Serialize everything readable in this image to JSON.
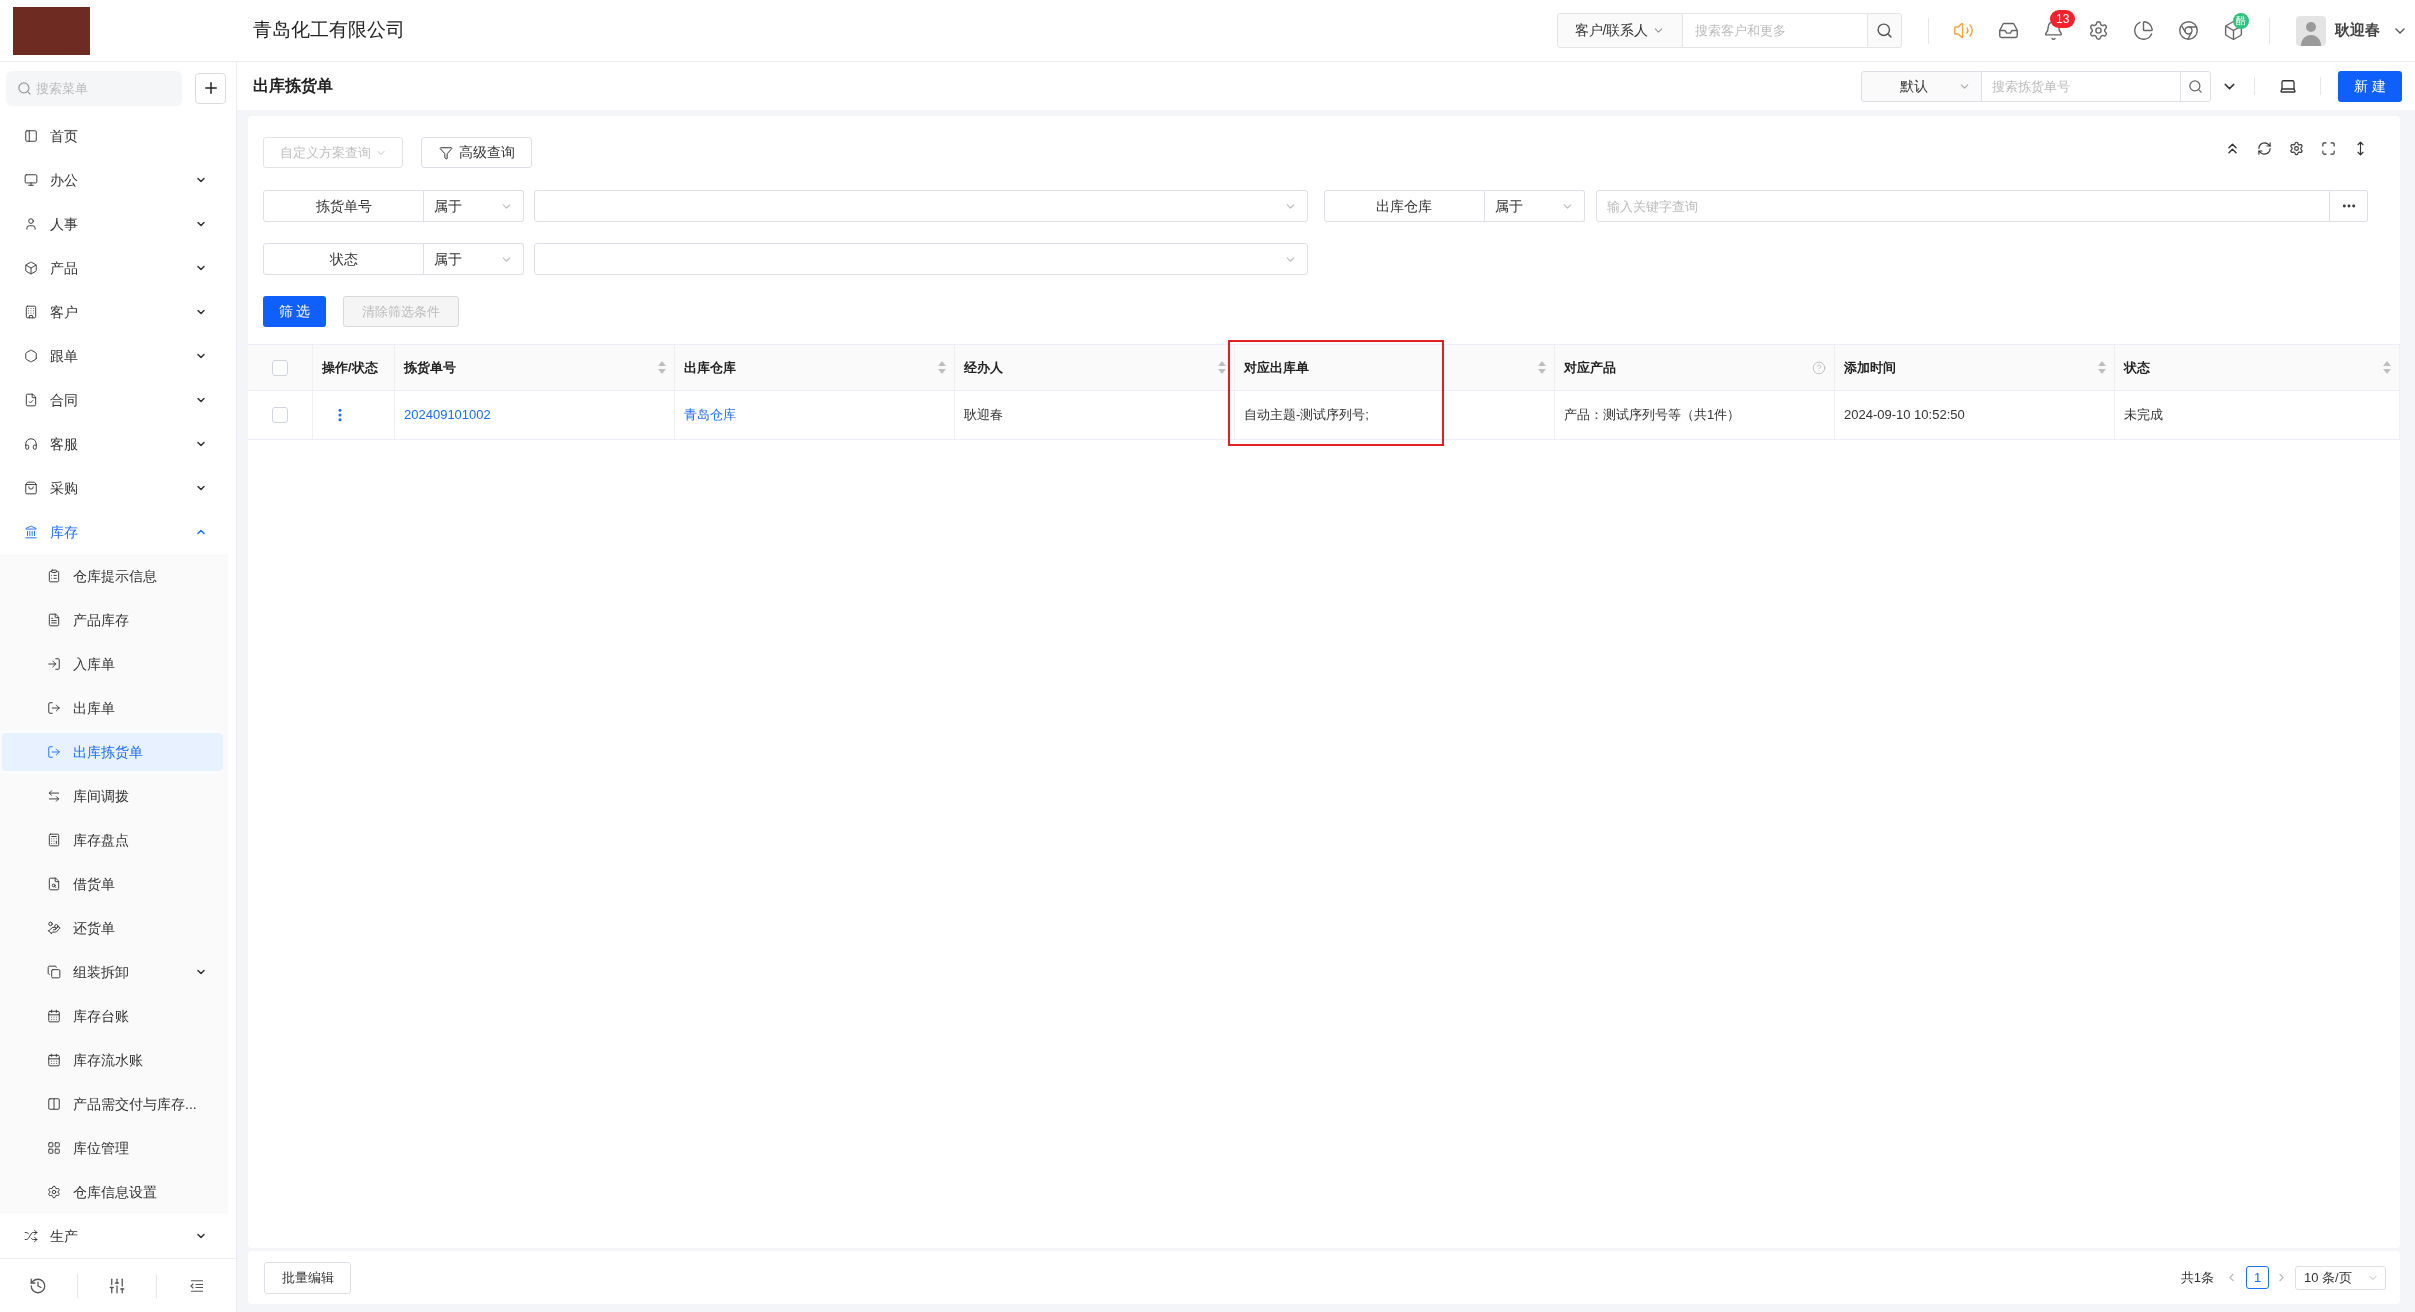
{
  "header": {
    "company_name": "青岛化工有限公司",
    "search": {
      "scope": "客户/联系人",
      "placeholder": "搜索客户和更多"
    },
    "notification_count": "13",
    "app_badge": "酷",
    "user_name": "耿迎春"
  },
  "sidebar": {
    "search": {
      "placeholder": "搜索菜单"
    },
    "items": [
      {
        "label": "首页",
        "selected": false
      },
      {
        "label": "办公",
        "selected": false,
        "expanded": false
      },
      {
        "label": "人事",
        "selected": false,
        "expanded": false
      },
      {
        "label": "产品",
        "selected": false,
        "expanded": false
      },
      {
        "label": "客户",
        "selected": false,
        "expanded": false
      },
      {
        "label": "跟单",
        "selected": false,
        "expanded": false
      },
      {
        "label": "合同",
        "selected": false,
        "expanded": false
      },
      {
        "label": "客服",
        "selected": false,
        "expanded": false
      },
      {
        "label": "采购",
        "selected": false,
        "expanded": false
      },
      {
        "label": "库存",
        "selected": false,
        "expanded": true,
        "children": [
          {
            "label": "仓库提示信息",
            "selected": false
          },
          {
            "label": "产品库存",
            "selected": false
          },
          {
            "label": "入库单",
            "selected": false
          },
          {
            "label": "出库单",
            "selected": false
          },
          {
            "label": "出库拣货单",
            "selected": true
          },
          {
            "label": "库间调拨",
            "selected": false
          },
          {
            "label": "库存盘点",
            "selected": false
          },
          {
            "label": "借货单",
            "selected": false
          },
          {
            "label": "还货单",
            "selected": false
          },
          {
            "label": "组装拆卸",
            "selected": false,
            "expanded": false
          },
          {
            "label": "库存台账",
            "selected": false
          },
          {
            "label": "库存流水账",
            "selected": false
          },
          {
            "label": "产品需交付与库存...",
            "selected": false
          },
          {
            "label": "库位管理",
            "selected": false
          },
          {
            "label": "仓库信息设置",
            "selected": false
          }
        ]
      },
      {
        "label": "生产",
        "selected": false,
        "expanded": false
      }
    ]
  },
  "page": {
    "title": "出库拣货单",
    "scheme": "默认",
    "search": {
      "placeholder": "搜索拣货单号"
    },
    "new_button": "新 建"
  },
  "query_bar": {
    "custom_scheme": {
      "label": "自定义方案查询",
      "disabled": true
    },
    "advanced_button": "高级查询"
  },
  "filters": [
    {
      "field": "拣货单号",
      "operator": "属于",
      "kind": "select"
    },
    {
      "field": "出库仓库",
      "operator": "属于",
      "kind": "keyword",
      "placeholder": "输入关键字查询"
    },
    {
      "field": "状态",
      "operator": "属于",
      "kind": "select"
    }
  ],
  "filter_actions": {
    "apply": "筛 选",
    "clear": {
      "label": "清除筛选条件",
      "disabled": true
    }
  },
  "table": {
    "all_checked": false,
    "columns": [
      {
        "label": "操作/状态",
        "kind": "actions",
        "highlighted": false
      },
      {
        "label": "拣货单号",
        "kind": "sortable",
        "highlighted": false
      },
      {
        "label": "出库仓库",
        "kind": "sortable",
        "highlighted": false
      },
      {
        "label": "经办人",
        "kind": "sortable",
        "highlighted": false
      },
      {
        "label": "对应出库单",
        "kind": "sortable",
        "highlighted": true
      },
      {
        "label": "对应产品",
        "kind": "info",
        "highlighted": false
      },
      {
        "label": "添加时间",
        "kind": "sortable",
        "highlighted": false
      },
      {
        "label": "状态",
        "kind": "sortable",
        "highlighted": false
      }
    ],
    "rows": [
      {
        "checked": false,
        "cells": [
          {
            "kind": "menu"
          },
          {
            "kind": "link",
            "text": "202409101002"
          },
          {
            "kind": "link",
            "text": "青岛仓库"
          },
          {
            "kind": "text",
            "text": "耿迎春"
          },
          {
            "kind": "text",
            "text": "自动主题-测试序列号;"
          },
          {
            "kind": "text",
            "text": "产品：测试序列号等（共1件）"
          },
          {
            "kind": "text",
            "text": "2024-09-10 10:52:50"
          },
          {
            "kind": "text",
            "text": "未完成"
          }
        ]
      }
    ]
  },
  "footer": {
    "batch_button": "批量编辑",
    "total": "共1条",
    "pages": [
      {
        "label": "1",
        "selected": true
      }
    ],
    "page_size": "10 条/页"
  }
}
